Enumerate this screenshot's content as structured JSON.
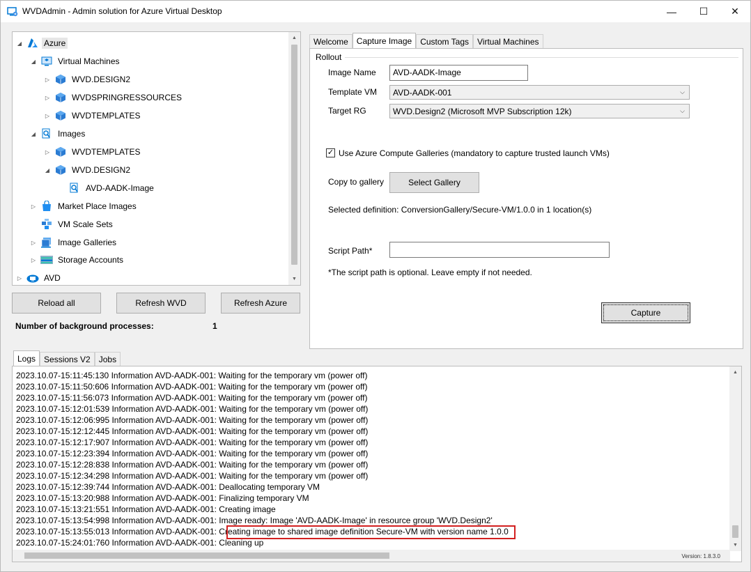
{
  "window": {
    "title": "WVDAdmin - Admin solution for Azure Virtual Desktop",
    "minimize": "—",
    "maximize": "☐",
    "close": "✕"
  },
  "tree": {
    "items": [
      {
        "label": "Azure",
        "icon": "azure-logo-icon",
        "expanded": true,
        "selected": true
      },
      {
        "label": "Virtual Machines",
        "icon": "virtual-machines-icon",
        "expanded": true
      },
      {
        "label": "WVD.DESIGN2",
        "icon": "cube-icon"
      },
      {
        "label": "WVDSPRINGRESSOURCES",
        "icon": "cube-icon"
      },
      {
        "label": "WVDTEMPLATES",
        "icon": "cube-icon"
      },
      {
        "label": "Images",
        "icon": "images-icon",
        "expanded": true
      },
      {
        "label": "WVDTEMPLATES",
        "icon": "cube-icon"
      },
      {
        "label": "WVD.DESIGN2",
        "icon": "cube-icon",
        "expanded": true
      },
      {
        "label": "AVD-AADK-Image",
        "icon": "image-icon"
      },
      {
        "label": "Market Place Images",
        "icon": "marketplace-icon"
      },
      {
        "label": "VM Scale Sets",
        "icon": "scale-sets-icon"
      },
      {
        "label": "Image Galleries",
        "icon": "gallery-icon"
      },
      {
        "label": "Storage Accounts",
        "icon": "storage-icon"
      },
      {
        "label": "AVD",
        "icon": "avd-cloud-icon"
      }
    ]
  },
  "buttons": {
    "reload_all": "Reload all",
    "refresh_wvd": "Refresh WVD",
    "refresh_azure": "Refresh Azure",
    "select_gallery": "Select Gallery",
    "capture": "Capture"
  },
  "status": {
    "bg_label": "Number of background processes:",
    "bg_count": "1"
  },
  "right_tabs": [
    "Welcome",
    "Capture Image",
    "Custom Tags",
    "Virtual Machines"
  ],
  "capture": {
    "group": "Rollout",
    "image_name_label": "Image Name",
    "image_name": "AVD-AADK-Image",
    "template_vm_label": "Template VM",
    "template_vm": "AVD-AADK-001",
    "target_rg_label": "Target RG",
    "target_rg": "WVD.Design2 (Microsoft MVP Subscription 12k)",
    "use_gallery_label": "Use Azure Compute Galleries (mandatory to capture trusted launch VMs)",
    "use_gallery_checked": true,
    "copy_gallery_label": "Copy to gallery",
    "selected_definition": "Selected definition: ConversionGallery/Secure-VM/1.0.0 in 1 location(s)",
    "script_path_label": "Script Path*",
    "script_path": "",
    "script_note": "*The script path is optional. Leave empty if not needed."
  },
  "bottom_tabs": [
    "Logs",
    "Sessions V2",
    "Jobs"
  ],
  "logs": [
    "2023.10.07-15:11:45:130 Information  AVD-AADK-001: Waiting for the temporary vm (power off)",
    "2023.10.07-15:11:50:606 Information  AVD-AADK-001: Waiting for the temporary vm (power off)",
    "2023.10.07-15:11:56:073 Information  AVD-AADK-001: Waiting for the temporary vm (power off)",
    "2023.10.07-15:12:01:539 Information  AVD-AADK-001: Waiting for the temporary vm (power off)",
    "2023.10.07-15:12:06:995 Information  AVD-AADK-001: Waiting for the temporary vm (power off)",
    "2023.10.07-15:12:12:445 Information  AVD-AADK-001: Waiting for the temporary vm (power off)",
    "2023.10.07-15:12:17:907 Information  AVD-AADK-001: Waiting for the temporary vm (power off)",
    "2023.10.07-15:12:23:394 Information  AVD-AADK-001: Waiting for the temporary vm (power off)",
    "2023.10.07-15:12:28:838 Information  AVD-AADK-001: Waiting for the temporary vm (power off)",
    "2023.10.07-15:12:34:298 Information  AVD-AADK-001: Waiting for the temporary vm (power off)",
    "2023.10.07-15:12:39:744 Information  AVD-AADK-001: Deallocating temporary VM",
    "2023.10.07-15:13:20:988 Information  AVD-AADK-001: Finalizing temporary VM",
    "2023.10.07-15:13:21:551 Information  AVD-AADK-001: Creating image",
    "2023.10.07-15:13:54:998 Information  AVD-AADK-001: Image ready: Image 'AVD-AADK-Image' in resource group 'WVD.Design2'",
    "2023.10.07-15:13:55:013 Information  AVD-AADK-001: Creating image to shared image definition Secure-VM with version name 1.0.0",
    "2023.10.07-15:24:01:760 Information  AVD-AADK-001: Cleaning up"
  ],
  "version": "Version: 1.8.3.0",
  "colors": {
    "azure_blue": "#0078d4",
    "highlight_red": "#d21f1f"
  }
}
